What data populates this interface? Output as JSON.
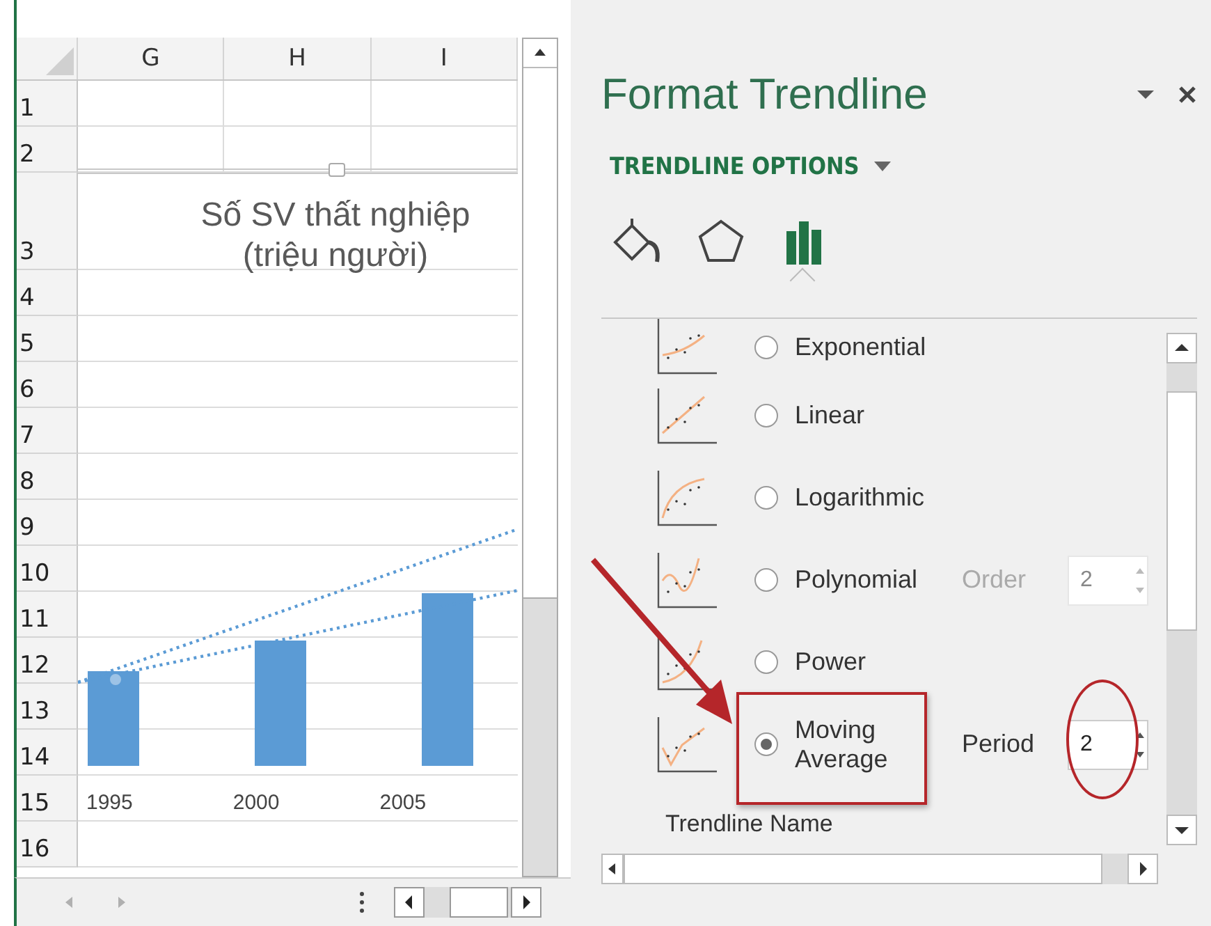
{
  "sheet": {
    "columns": [
      "G",
      "H",
      "I"
    ],
    "rows": [
      "1",
      "2",
      "3",
      "4",
      "5",
      "6",
      "7",
      "8",
      "9",
      "10",
      "11",
      "12",
      "13",
      "14",
      "15",
      "16"
    ],
    "chart": {
      "title_lines": [
        "Số SV thất nghiệp",
        "(triệu người)"
      ],
      "categories": [
        "1995",
        "2000",
        "2005"
      ]
    }
  },
  "pane": {
    "title": "Format Trendline",
    "section": "TRENDLINE OPTIONS",
    "tabs": [
      {
        "kind": "fill",
        "selected": false
      },
      {
        "kind": "effects",
        "selected": false
      },
      {
        "kind": "options",
        "selected": true
      }
    ],
    "options": [
      {
        "kind": "plain",
        "label": "Exponential",
        "selected": false
      },
      {
        "kind": "plain",
        "label": "Linear",
        "selected": false
      },
      {
        "kind": "plain",
        "label": "Logarithmic",
        "selected": false
      },
      {
        "kind": "param",
        "label": "Polynomial",
        "selected": false,
        "param_label": "Order",
        "param_value": "2",
        "disabled": true
      },
      {
        "kind": "plain",
        "label": "Power",
        "selected": false
      },
      {
        "kind": "param",
        "label": "Moving Average",
        "selected": true,
        "param_label": "Period",
        "param_value": "2",
        "disabled": false
      }
    ],
    "trendline_name_label": "Trendline Name"
  }
}
